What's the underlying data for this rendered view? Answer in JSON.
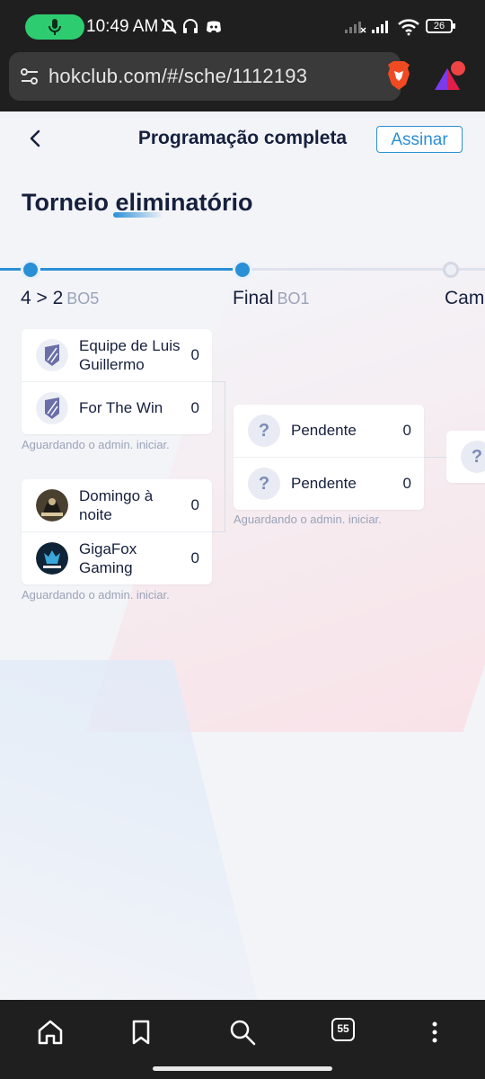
{
  "status_bar": {
    "time": "10:49 AM",
    "battery": "26",
    "icons": [
      "mic-icon",
      "bell-off-icon",
      "headphones-icon",
      "discord-icon",
      "signal-off-icon",
      "signal-icon",
      "wifi-icon",
      "battery-icon"
    ]
  },
  "browser": {
    "url": "hokclub.com/#/sche/1112193",
    "tabs_count": "55",
    "icons": [
      "tune-icon",
      "brave-lion-icon",
      "rewards-icon"
    ]
  },
  "header": {
    "title": "Programação completa",
    "subscribe_label": "Assinar"
  },
  "tournament": {
    "title": "Torneio eliminatório",
    "stages": [
      {
        "label": "4 > 2",
        "format": "BO5"
      },
      {
        "label": "Final",
        "format": "BO1"
      },
      {
        "label": "Cam",
        "format": ""
      }
    ],
    "rounds": [
      {
        "matches": [
          {
            "teams": [
              {
                "name": "Equipe de Luis Guillermo",
                "score": "0"
              },
              {
                "name": "For The Win",
                "score": "0"
              }
            ],
            "status": "Aguardando o admin. iniciar."
          },
          {
            "teams": [
              {
                "name": "Domingo à noite",
                "score": "0"
              },
              {
                "name": "GigaFox Gaming",
                "score": "0"
              }
            ],
            "status": "Aguardando o admin. iniciar."
          }
        ]
      },
      {
        "matches": [
          {
            "teams": [
              {
                "name": "Pendente",
                "score": "0"
              },
              {
                "name": "Pendente",
                "score": "0"
              }
            ],
            "status": "Aguardando o admin. iniciar."
          }
        ]
      }
    ],
    "pending_symbol": "?"
  },
  "bottom_nav": {
    "items": [
      "home-icon",
      "bookmark-icon",
      "search-icon",
      "tabs-icon",
      "menu-icon"
    ]
  },
  "colors": {
    "accent": "#2b8fd6",
    "text": "#16203d",
    "muted": "#9aa3b8",
    "browser_chrome": "#1f1f1f"
  }
}
